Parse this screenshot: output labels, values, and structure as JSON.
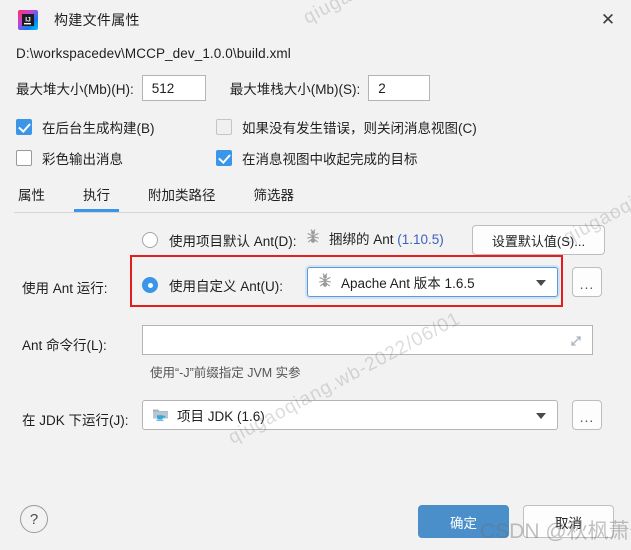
{
  "window": {
    "title": "构建文件属性",
    "icon": "intellij-idea-icon",
    "close_label": "✕"
  },
  "file_path": "D:\\workspacedev\\MCCP_dev_1.0.0\\build.xml",
  "heap": {
    "max_heap_label": "最大堆大小(Mb)(H):",
    "max_heap_value": "512",
    "max_stack_label": "最大堆栈大小(Mb)(S):",
    "max_stack_value": "2"
  },
  "checkboxes": [
    {
      "label": "在后台生成构建(B)",
      "checked": true
    },
    {
      "label": "如果没有发生错误，则关闭消息视图(C)",
      "checked": false
    },
    {
      "label": "彩色输出消息",
      "checked": false
    },
    {
      "label": "在消息视图中收起完成的目标",
      "checked": true
    }
  ],
  "tabs": [
    {
      "label": "属性",
      "active": false
    },
    {
      "label": "执行",
      "active": true
    },
    {
      "label": "附加类路径",
      "active": false
    },
    {
      "label": "筛选器",
      "active": false
    }
  ],
  "execution": {
    "run_with_label": "使用 Ant 运行:",
    "use_project_default": {
      "label": "使用项目默认 Ant(D):",
      "selected": false
    },
    "bundled": {
      "icon": "ant-icon",
      "text": "捆绑的 Ant ",
      "version": "(1.10.5)"
    },
    "set_defaults_button": "设置默认值(S)...",
    "use_custom": {
      "label": "使用自定义 Ant(U):",
      "selected": true
    },
    "ant_combo": {
      "icon": "ant-icon",
      "value": "Apache Ant 版本 1.6.5",
      "browse_label": "..."
    },
    "command_line": {
      "label": "Ant 命令行(L):",
      "value": "",
      "placeholder": "",
      "expand_icon": "expand-icon",
      "hint": "使用“-J”前缀指定 JVM 实参"
    },
    "jdk": {
      "label": "在 JDK 下运行(J):",
      "icon": "jdk-folder-icon",
      "value": "项目 JDK (1.6)",
      "browse_label": "..."
    }
  },
  "footer": {
    "help_label": "?",
    "ok_label": "确定",
    "cancel_label": "取消"
  },
  "watermarks": {
    "text_a": "qiugaoqiang.wb-2022/06/01",
    "text_b": "qiugaoqiang.wb-2022/06/01",
    "text_c": "qiugaoqiang.wb-2022/06/01",
    "csdn": "CSDN @秋枫萧竹"
  },
  "colors": {
    "accent": "#3b95e8",
    "ok_button": "#4a8fca",
    "highlight_box": "#e41d1d",
    "version_link": "#3f5fbf",
    "background": "#f2f2f2"
  }
}
